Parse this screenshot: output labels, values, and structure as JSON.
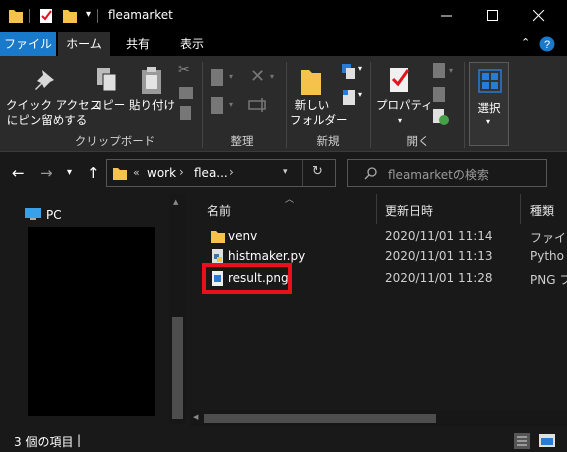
{
  "window": {
    "title": "fleamarket"
  },
  "ribbon_tabs": [
    "ファイル",
    "ホーム",
    "共有",
    "表示"
  ],
  "ribbon": {
    "pin_label_1": "クイック アクセス",
    "pin_label_2": "にピン留めする",
    "copy_label": "コピー",
    "paste_label": "貼り付け",
    "group_clipboard": "クリップボード",
    "group_organize": "整理",
    "new_folder_label_1": "新しい",
    "new_folder_label_2": "フォルダー",
    "group_new": "新規",
    "properties_label": "プロパティ",
    "group_open": "開く",
    "select_label": "選択"
  },
  "address": {
    "overflow": "«",
    "crumbs": [
      "work",
      "flea..."
    ],
    "separator": "›"
  },
  "search": {
    "placeholder": "fleamarketの検索"
  },
  "nav_pane": {
    "pc_label": "PC"
  },
  "columns": {
    "name": "名前",
    "date": "更新日時",
    "type": "種類"
  },
  "files": [
    {
      "name": "venv",
      "date": "2020/11/01 11:14",
      "type": "ファイル",
      "icon": "folder-icon"
    },
    {
      "name": "histmaker.py",
      "date": "2020/11/01 11:13",
      "type": "Pytho",
      "icon": "python-file-icon"
    },
    {
      "name": "result.png",
      "date": "2020/11/01 11:28",
      "type": "PNG フ",
      "icon": "image-file-icon"
    }
  ],
  "status": {
    "count_text": "3 個の項目",
    "divider": "|"
  },
  "colors": {
    "accent": "#1979ca",
    "highlight": "#e8101a",
    "folder": "#f5c24c"
  }
}
